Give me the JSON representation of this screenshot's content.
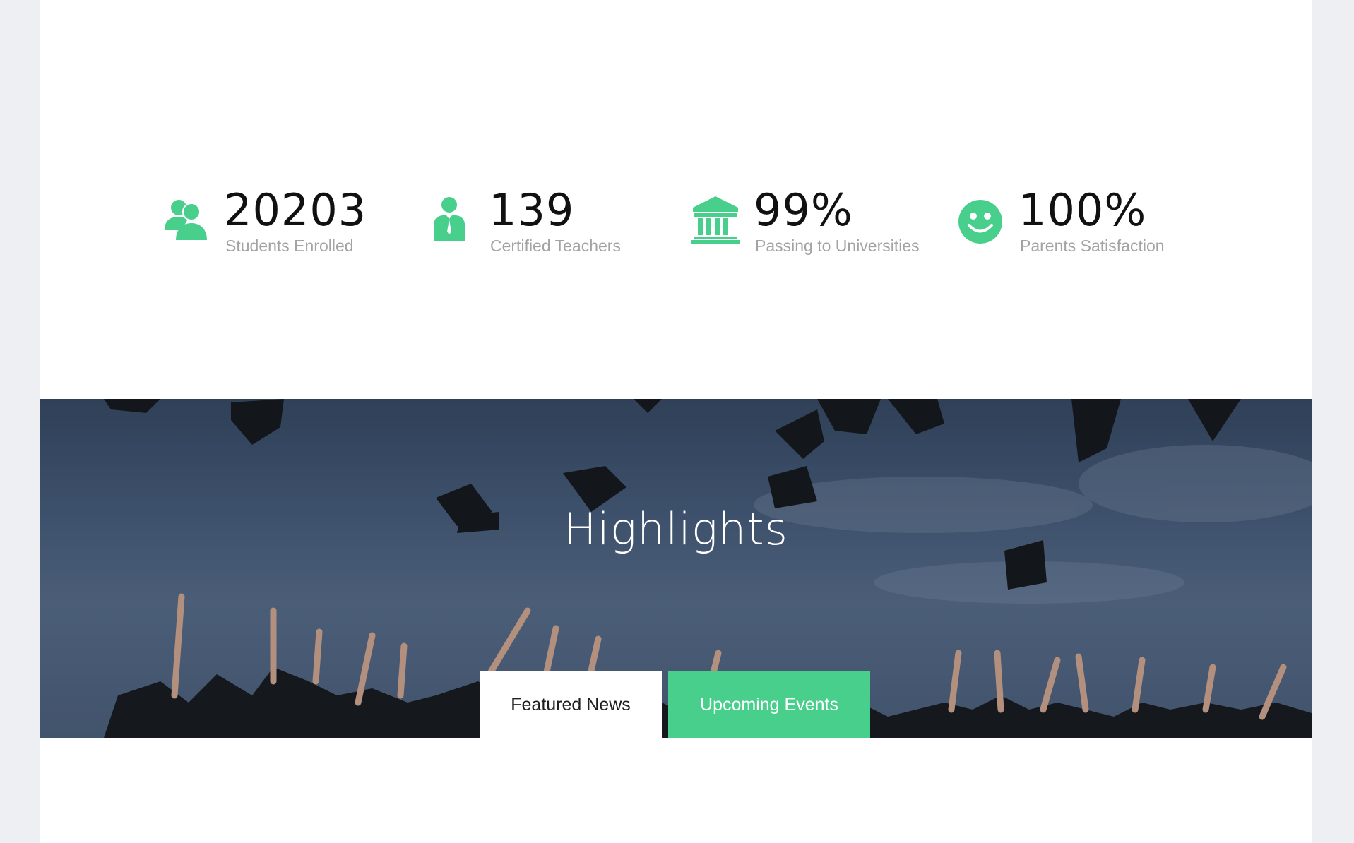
{
  "stats": [
    {
      "icon": "users-icon",
      "number": "20203",
      "label": "Students Enrolled"
    },
    {
      "icon": "teacher-icon",
      "number": "139",
      "label": "Certified Teachers"
    },
    {
      "icon": "university-icon",
      "number": "99%",
      "label": "Passing to Universities"
    },
    {
      "icon": "smile-icon",
      "number": "100%",
      "label": "Parents Satisfaction"
    }
  ],
  "highlights": {
    "title": "Highlights",
    "tabs": [
      {
        "label": "Featured News",
        "active": true
      },
      {
        "label": "Upcoming Events",
        "active": false
      }
    ]
  },
  "colors": {
    "accent": "#48cf8c",
    "background": "#eeeff2",
    "page": "#ffffff",
    "label_gray": "#a3a3a3"
  }
}
